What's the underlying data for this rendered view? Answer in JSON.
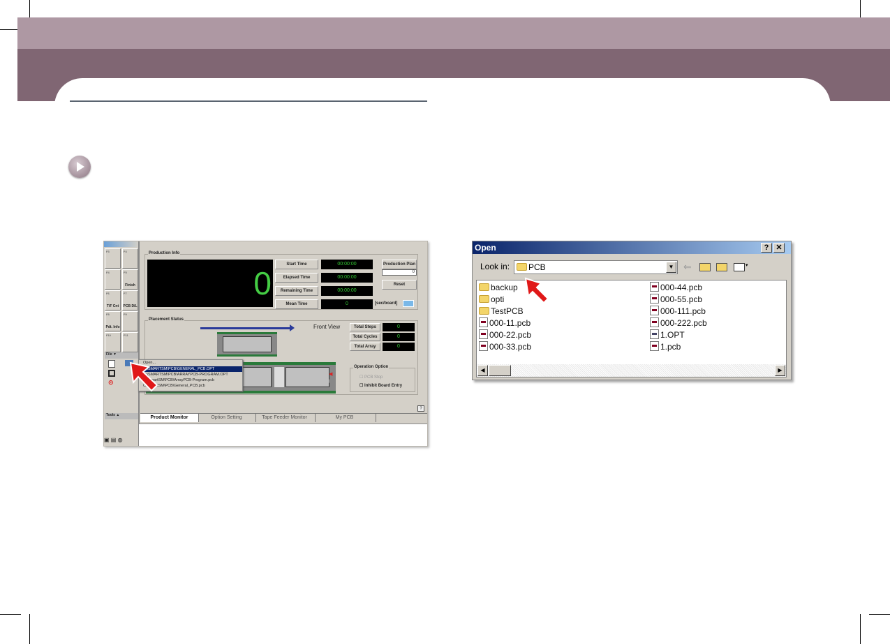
{
  "page": {
    "colors": {
      "band_light": "#ae98a3",
      "band_dark": "#806673"
    },
    "bullet_icon": "play-circle-icon"
  },
  "app": {
    "function_keys": [
      {
        "key": "F3",
        "label": ""
      },
      {
        "key": "F4",
        "label": ""
      },
      {
        "key": "F4",
        "label": ""
      },
      {
        "key": "F5",
        "label": "Finish"
      },
      {
        "key": "F6",
        "label": "T/F Cnt"
      },
      {
        "key": "F7",
        "label": "PCB D/L"
      },
      {
        "key": "F8",
        "label": "Pdt. Info"
      },
      {
        "key": "F9",
        "label": ""
      },
      {
        "key": "F10",
        "label": ""
      },
      {
        "key": "F11",
        "label": ""
      }
    ],
    "file_panel": "File",
    "tools_panel": "Tools",
    "production_info": {
      "title": "Production Info",
      "count": "0",
      "rows": [
        {
          "label": "Start Time",
          "value": "00:00:00"
        },
        {
          "label": "Elapsed Time",
          "value": "00:00:00"
        },
        {
          "label": "Remaining Time",
          "value": "00:00:00"
        },
        {
          "label": "Mean Time",
          "value": "0"
        }
      ],
      "unit": "[sec/board]",
      "plan_label": "Production Plan",
      "plan_value": "0",
      "reset": "Reset"
    },
    "placement_status": {
      "title": "Placement Status",
      "view": "Front View",
      "totals": [
        {
          "label": "Total Steps",
          "value": "0"
        },
        {
          "label": "Total Cycles",
          "value": "0"
        },
        {
          "label": "Total Array",
          "value": "0"
        }
      ]
    },
    "operation_option": {
      "title": "Operation Option",
      "options": [
        {
          "label": "PCB Stop",
          "enabled": false,
          "checked": false
        },
        {
          "label": "Inhibit Board Entry",
          "enabled": true,
          "checked": false
        }
      ]
    },
    "menu": {
      "open": "Open...",
      "recent": [
        "C:\\SMARTSM\\PCB\\GENERAL_PCB.OPT",
        "C:\\SMARTSM\\PCB\\ARRAYPCB-PROGRAM.OPT",
        "C:\\SmartSM\\PCB\\ArrayPCB-Program.pcb",
        "C:\\SmartSM\\PCB\\General_PCB.pcb"
      ]
    },
    "help": "?",
    "tabs": [
      "Product Monitor",
      "Option Setting",
      "Tape Feeder Monitor",
      "My PCB"
    ],
    "active_tab": "Product Monitor"
  },
  "dialog": {
    "title": "Open",
    "help": "?",
    "close": "✕",
    "look_in_label": "Look in:",
    "look_in_value": "PCB",
    "items_left": [
      {
        "name": "backup",
        "type": "folder"
      },
      {
        "name": "opti",
        "type": "folder"
      },
      {
        "name": "TestPCB",
        "type": "folder"
      },
      {
        "name": "000-11.pcb",
        "type": "pcb"
      },
      {
        "name": "000-22.pcb",
        "type": "pcb"
      },
      {
        "name": "000-33.pcb",
        "type": "pcb"
      }
    ],
    "items_right": [
      {
        "name": "000-44.pcb",
        "type": "pcb"
      },
      {
        "name": "000-55.pcb",
        "type": "pcb"
      },
      {
        "name": "000-111.pcb",
        "type": "pcb"
      },
      {
        "name": "000-222.pcb",
        "type": "pcb"
      },
      {
        "name": "1.OPT",
        "type": "opt"
      },
      {
        "name": "1.pcb",
        "type": "pcb"
      }
    ]
  }
}
